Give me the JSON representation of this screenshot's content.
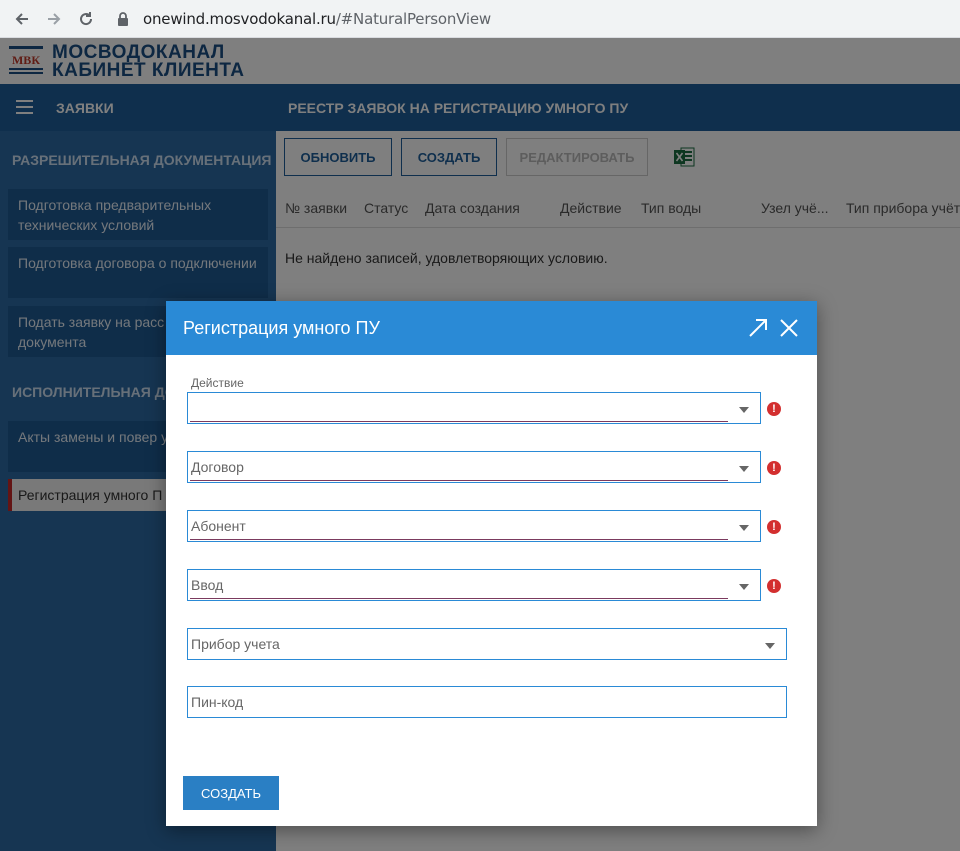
{
  "browser": {
    "url_host": "onewind.mosvodokanal.ru",
    "url_path": "/#NaturalPersonView"
  },
  "brand": {
    "line1": "МОСВОДОКАНАЛ",
    "line2": "КАБИНЕТ КЛИЕНТА",
    "logo_text": "МВК"
  },
  "topbar": {
    "menu_label": "ЗАЯВКИ",
    "title": "РЕЕСТР ЗАЯВОК НА РЕГИСТРАЦИЮ УМНОГО ПУ"
  },
  "sidebar": {
    "section1": "РАЗРЕШИТЕЛЬНАЯ ДОКУМЕНТАЦИЯ",
    "section2": "ИСПОЛНИТЕЛЬНАЯ ДОКУ",
    "items": [
      {
        "label": "Подготовка предварительных технических условий"
      },
      {
        "label": "Подготовка договора о подключении"
      },
      {
        "label": "Подать заявку на расс проектной документа"
      },
      {
        "label": "Акты замены и повер учета"
      },
      {
        "label": "Регистрация умного П"
      }
    ]
  },
  "toolbar": {
    "refresh": "ОБНОВИТЬ",
    "create": "СОЗДАТЬ",
    "edit": "РЕДАКТИРОВАТЬ"
  },
  "grid": {
    "columns": [
      "№ заявки",
      "Статус",
      "Дата создания",
      "Действие",
      "Тип воды",
      "Узел учё...",
      "Тип прибора учёт"
    ],
    "empty_message": "Не найдено записей, удовлетворяющих условию."
  },
  "dialog": {
    "title": "Регистрация умного ПУ",
    "action_label": "Действие",
    "fields": {
      "action_value": "",
      "contract_placeholder": "Договор",
      "subscriber_placeholder": "Абонент",
      "input_placeholder": "Ввод",
      "meter_placeholder": "Прибор учета",
      "pin_placeholder": "Пин-код"
    },
    "error_mark": "!",
    "create_button": "СОЗДАТЬ"
  },
  "colors": {
    "primary": "#1e5f9b",
    "dialog_header": "#2a8ad6",
    "error": "#d32f2f"
  }
}
